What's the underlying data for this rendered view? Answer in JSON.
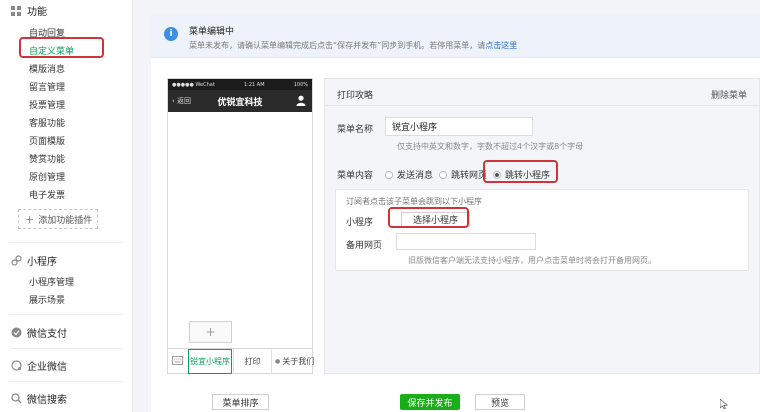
{
  "sidebar": {
    "sections": [
      {
        "title": "功能",
        "icon": "grid-icon"
      },
      {
        "title": "小程序",
        "icon": "link-icon"
      },
      {
        "title": "微信支付",
        "icon": "pay-icon"
      },
      {
        "title": "企业微信",
        "icon": "chat-icon"
      },
      {
        "title": "微信搜索",
        "icon": "search-icon"
      }
    ],
    "function_items": [
      "自动回复",
      "自定义菜单",
      "模版消息",
      "留言管理",
      "投票管理",
      "客服功能",
      "页面模版",
      "赞赏功能",
      "原创管理",
      "电子发票"
    ],
    "add_plugin_label": "添加功能插件",
    "miniprogram_items": [
      "小程序管理",
      "展示场景"
    ]
  },
  "notice": {
    "title": "菜单编辑中",
    "desc_prefix": "菜单未发布，请确认菜单编辑完成后点击“保存并发布”同步到手机。若停用菜单，请",
    "desc_link": "点击这里"
  },
  "phone": {
    "carrier": "●●●●● WeChat",
    "time": "1:21 AM",
    "battery": "100%",
    "back_label": "返回",
    "title": "优锐宜科技",
    "add_symbol": "+",
    "menu_tabs": [
      "锐宜小程序",
      "打印",
      "关于我们"
    ]
  },
  "editor": {
    "header": "打印攻略",
    "delete_label": "删除菜单",
    "name_label": "菜单名称",
    "name_value": "锐宜小程序",
    "name_hint": "仅支持中英文和数字，字数不超过4个汉字或8个字母",
    "content_label": "菜单内容",
    "content_options": [
      "发送消息",
      "跳转网页",
      "跳转小程序"
    ],
    "selected_option": "跳转小程序",
    "jump_desc": "订阅者点击该子菜单会跳到以下小程序",
    "miniprogram_label": "小程序",
    "select_button": "选择小程序",
    "backup_label": "备用网页",
    "backup_value": "",
    "backup_hint": "旧版微信客户端无法支持小程序，用户点击菜单时将会打开备用网页。"
  },
  "footer": {
    "sort_button": "菜单排序",
    "save_button": "保存并发布",
    "preview_button": "预览"
  },
  "colors": {
    "accent_green": "#1aad19",
    "active_text": "#07a35a",
    "highlight_red": "#d0343b",
    "info_blue": "#3d8fe2"
  }
}
